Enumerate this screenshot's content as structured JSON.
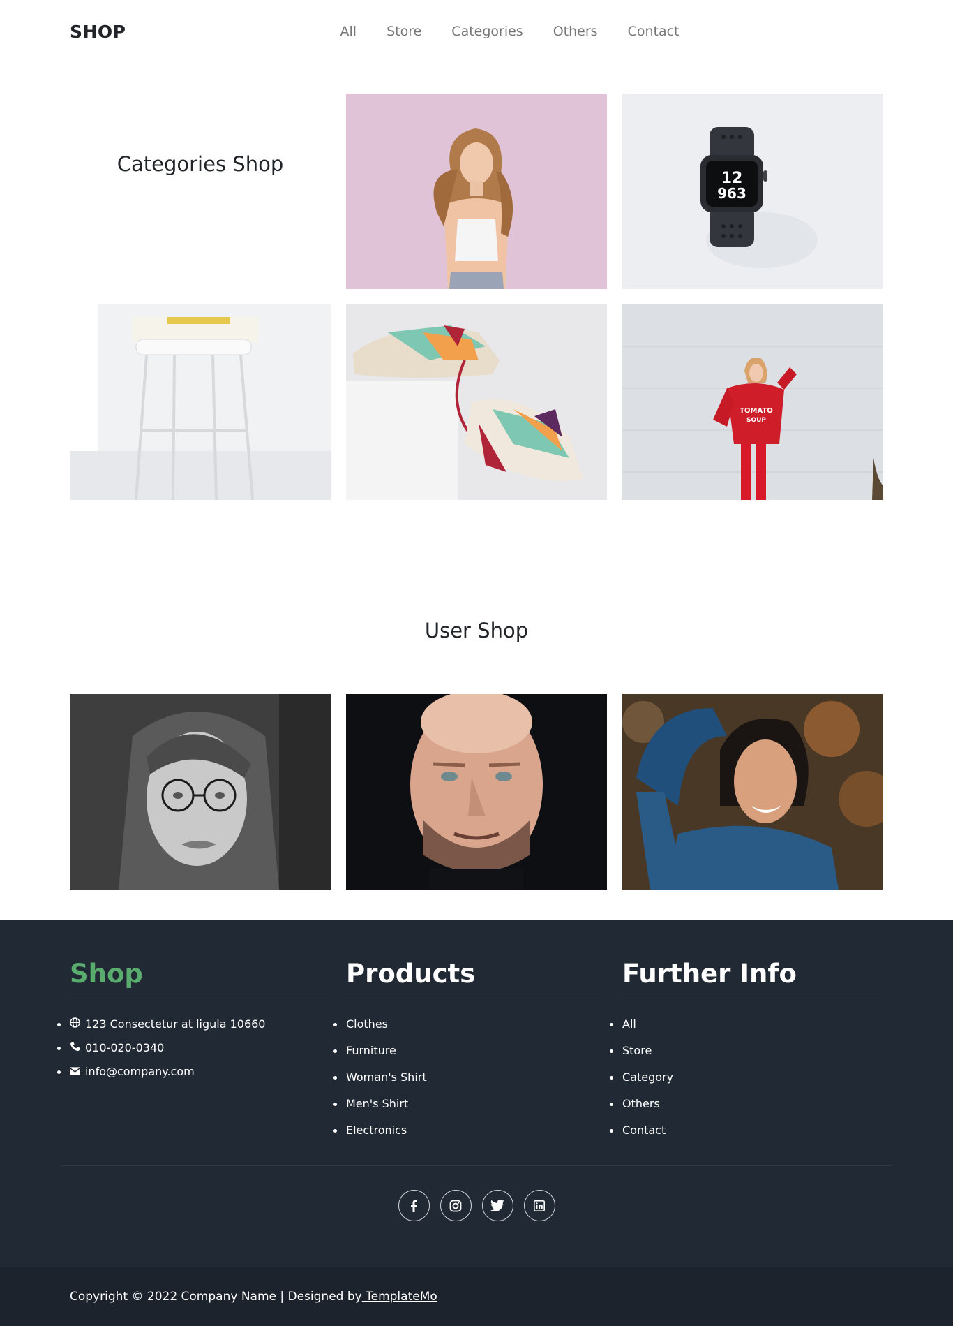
{
  "header": {
    "brand": "SHOP",
    "menu": [
      "All",
      "Store",
      "Categories",
      "Others",
      "Contact"
    ]
  },
  "categories": {
    "title": "Categories Shop",
    "images": [
      "woman-pink-background",
      "smartwatch",
      "stool-with-book",
      "sneakers",
      "woman-red-sweater"
    ]
  },
  "users": {
    "title": "User Shop",
    "images": [
      "woman-glasses-bw",
      "bald-man",
      "smiling-woman-blue-sweater"
    ]
  },
  "footer": {
    "shop": {
      "title": "Shop",
      "address": "123 Consectetur at ligula 10660",
      "phone": "010-020-0340",
      "email": "info@company.com"
    },
    "products": {
      "title": "Products",
      "items": [
        "Clothes",
        "Furniture",
        "Woman's Shirt",
        "Men's Shirt",
        "Electronics"
      ]
    },
    "info": {
      "title": "Further Info",
      "items": [
        "All",
        "Store",
        "Category",
        "Others",
        "Contact"
      ]
    },
    "social": [
      "facebook-icon",
      "instagram-icon",
      "twitter-icon",
      "linkedin-icon"
    ],
    "copyright": "Copyright © 2022 Company Name | Designed by",
    "designer_link": " TemplateMo"
  },
  "colors": {
    "accent_green": "#59ab6e",
    "footer_bg": "#212934",
    "bottom_bar_bg": "#1d232c"
  }
}
